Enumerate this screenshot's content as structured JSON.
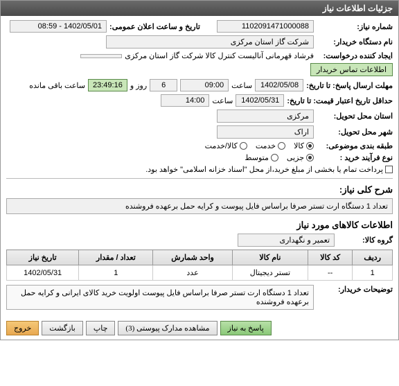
{
  "panel_title": "جزئیات اطلاعات نیاز",
  "fields": {
    "need_no_label": "شماره نیاز:",
    "need_no": "1102091471000088",
    "announce_label": "تاریخ و ساعت اعلان عمومی:",
    "announce_value": "1402/05/01 - 08:59",
    "org_label": "نام دستگاه خریدار:",
    "org_value": "شرکت گاز استان مرکزی",
    "creator_label": "ایجاد کننده درخواست:",
    "creator_value": "فرشاد قهرمانی آنالیست کنترل کالا شرکت گاز استان مرکزی",
    "contact_btn": "اطلاعات تماس خریدار",
    "deadline_label": "مهلت ارسال پاسخ: تا تاریخ:",
    "deadline_date": "1402/05/08",
    "time_label": "ساعت",
    "deadline_time": "09:00",
    "day_label": "روز و",
    "days_value": "6",
    "remaining_time": "23:49:16",
    "remaining_label": "ساعت باقی مانده",
    "validity_label": "حداقل تاریخ اعتبار قیمت: تا تاریخ:",
    "validity_date": "1402/05/31",
    "validity_time": "14:00",
    "province_label": "استان محل تحویل:",
    "province_value": "مرکزی",
    "city_label": "شهر محل تحویل:",
    "city_value": "اراک",
    "category_label": "طبقه بندی موضوعی:",
    "cat_goods": "کالا",
    "cat_service": "خدمت",
    "cat_both": "کالا/خدمت",
    "process_label": "نوع فرآیند خرید :",
    "proc_partial": "جزیی",
    "proc_medium": "متوسط",
    "payment_note": "پرداخت تمام یا بخشی از مبلغ خرید،از محل \"اسناد خزانه اسلامی\" خواهد بود.",
    "subject_label": "شرح کلی نیاز:",
    "subject_value": "تعداد 1 دستگاه ارت تستر صرفا براساس فایل پیوست و کرایه حمل برعهده فروشنده",
    "items_title": "اطلاعات کالاهای مورد نیاز",
    "group_label": "گروه کالا:",
    "group_value": "تعمیر و نگهداری",
    "buyer_desc_label": "توضیحات خریدار:",
    "buyer_desc_value": "تعداد 1 دستگاه ارت تستر صرفا براساس فایل پیوست اولویت خرید کالای ایرانی و کرایه حمل برعهده فروشنده"
  },
  "table": {
    "headers": [
      "ردیف",
      "کد کالا",
      "نام کالا",
      "واحد شمارش",
      "تعداد / مقدار",
      "تاریخ نیاز"
    ],
    "rows": [
      {
        "idx": "1",
        "code": "--",
        "name": "تستر دیجیتال",
        "unit": "عدد",
        "qty": "1",
        "date": "1402/05/31"
      }
    ]
  },
  "buttons": {
    "reply": "پاسخ به نیاز",
    "attachments": "مشاهده مدارک پیوستی (3)",
    "print": "چاپ",
    "back": "بازگشت",
    "exit": "خروج"
  }
}
